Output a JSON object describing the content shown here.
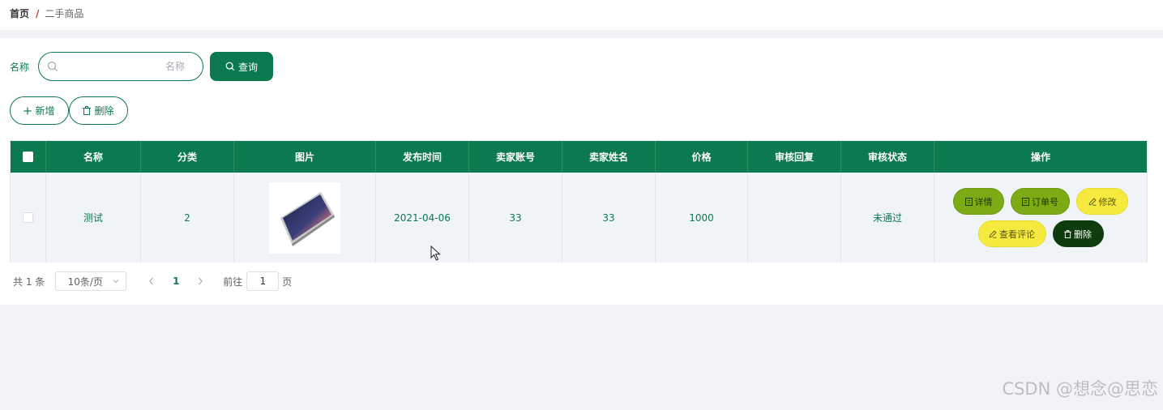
{
  "breadcrumb": {
    "home": "首页",
    "separator": "/",
    "current": "二手商品"
  },
  "search": {
    "label": "名称",
    "placeholder": "名称",
    "value": "",
    "query_label": "查询",
    "icon": "search-icon"
  },
  "toolbar": {
    "add_label": "新增",
    "delete_label": "删除",
    "add_icon": "plus-icon",
    "delete_icon": "trash-icon"
  },
  "table": {
    "columns": [
      "",
      "名称",
      "分类",
      "图片",
      "发布时间",
      "卖家账号",
      "卖家姓名",
      "价格",
      "审核回复",
      "审核状态",
      "操作"
    ],
    "rows": [
      {
        "checked": false,
        "name": "测试",
        "category": "2",
        "image": "tablet-product-photo",
        "publish_time": "2021-04-06",
        "seller_account": "33",
        "seller_name": "33",
        "price": "1000",
        "review_reply": "",
        "review_status": "未通过",
        "actions": {
          "detail": "详情",
          "order_no": "订单号",
          "edit": "修改",
          "view_comments": "查看评论",
          "delete": "删除"
        }
      }
    ]
  },
  "pagination": {
    "total_text": "共 1 条",
    "page_size": "10条/页",
    "current_page": "1",
    "goto_label": "前往",
    "goto_value": "1",
    "page_suffix": "页"
  },
  "watermark": "CSDN @想念@思恋",
  "colors": {
    "primary": "#0b7a4e",
    "action_green": "#7dab15",
    "action_yellow": "#f5ea3d",
    "action_dark": "#0f3c0d",
    "breadcrumb_separator": "#c0392b"
  }
}
